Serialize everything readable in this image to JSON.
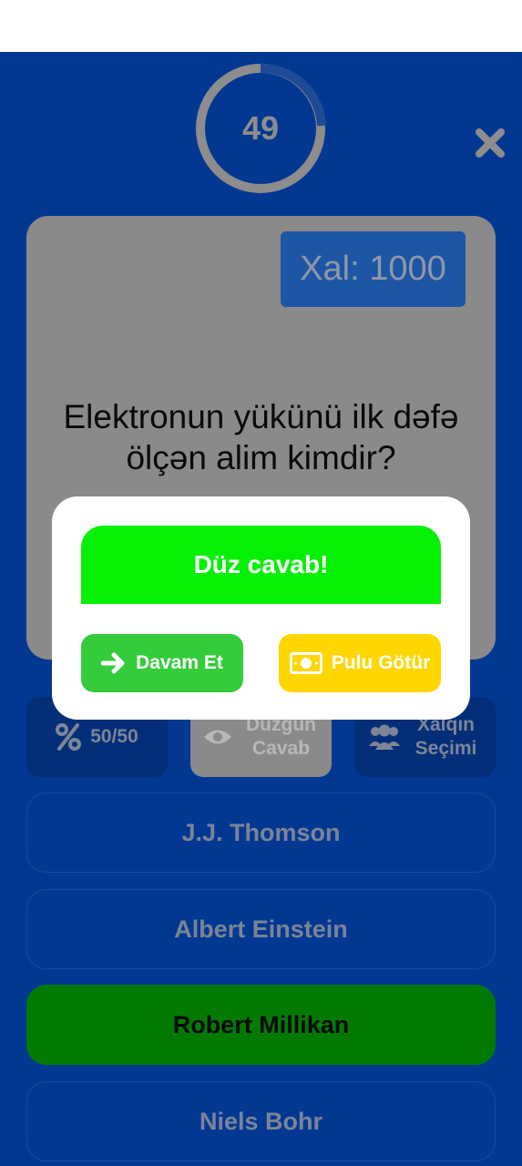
{
  "timer": {
    "value": "49"
  },
  "score": {
    "label": "Xal: 1000"
  },
  "question": {
    "text": "Elektronun yükünü ilk dəfə ölçən alim kimdir?"
  },
  "lifelines": [
    {
      "label": "50/50",
      "icon": "percent-icon"
    },
    {
      "label": "Düzgün Cavab",
      "icon": "eye-icon"
    },
    {
      "label": "Xalqın Seçimi",
      "icon": "users-icon"
    }
  ],
  "answers": [
    {
      "label": "J.J. Thomson",
      "state": "default"
    },
    {
      "label": "Albert Einstein",
      "state": "default"
    },
    {
      "label": "Robert Millikan",
      "state": "correct"
    },
    {
      "label": "Niels Bohr",
      "state": "default"
    }
  ],
  "dialog": {
    "result": "Düz cavab!",
    "continue_label": "Davam Et",
    "take_money_label": "Pulu Götür"
  },
  "colors": {
    "background": "#033892",
    "correct": "#027a02",
    "banner": "#06f006",
    "continue": "#35cc3c",
    "take_money": "#ffd600"
  }
}
